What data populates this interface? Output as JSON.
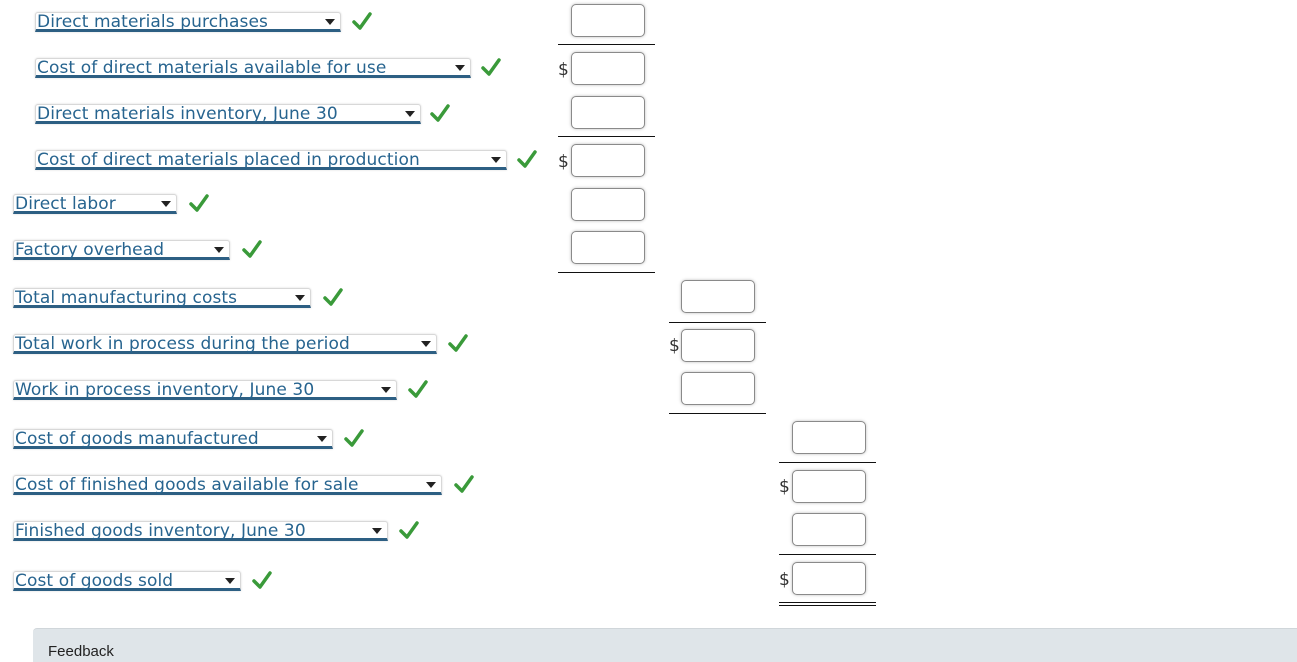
{
  "rows": [
    {
      "label": "Direct materials purchases",
      "status": "correct",
      "dollar": false
    },
    {
      "label": "Cost of direct materials available for use",
      "status": "correct",
      "dollar": true
    },
    {
      "label": "Direct materials inventory, June 30",
      "status": "correct",
      "dollar": false
    },
    {
      "label": "Cost of direct materials placed in production",
      "status": "correct",
      "dollar": true
    },
    {
      "label": "Direct labor",
      "status": "correct",
      "dollar": false
    },
    {
      "label": "Factory overhead",
      "status": "correct",
      "dollar": false
    },
    {
      "label": "Total manufacturing costs",
      "status": "correct",
      "dollar": false
    },
    {
      "label": "Total work in process during the period",
      "status": "correct",
      "dollar": true
    },
    {
      "label": "Work in process inventory, June 30",
      "status": "correct",
      "dollar": false
    },
    {
      "label": "Cost of goods manufactured",
      "status": "correct",
      "dollar": false
    },
    {
      "label": "Cost of finished goods available for sale",
      "status": "correct",
      "dollar": true
    },
    {
      "label": "Finished goods inventory, June 30",
      "status": "correct",
      "dollar": false
    },
    {
      "label": "Cost of goods sold",
      "status": "correct",
      "dollar": true
    }
  ],
  "inputs": [
    "",
    "",
    "",
    "",
    "",
    "",
    "",
    "",
    "",
    "",
    "",
    "",
    ""
  ],
  "currency_symbol": "$",
  "feedback": {
    "label": "Feedback"
  },
  "colors": {
    "select_text": "#27648f",
    "select_underline": "#2d5f83",
    "check": "#3a9a3a",
    "feedback_bg": "#dfe5e9"
  }
}
